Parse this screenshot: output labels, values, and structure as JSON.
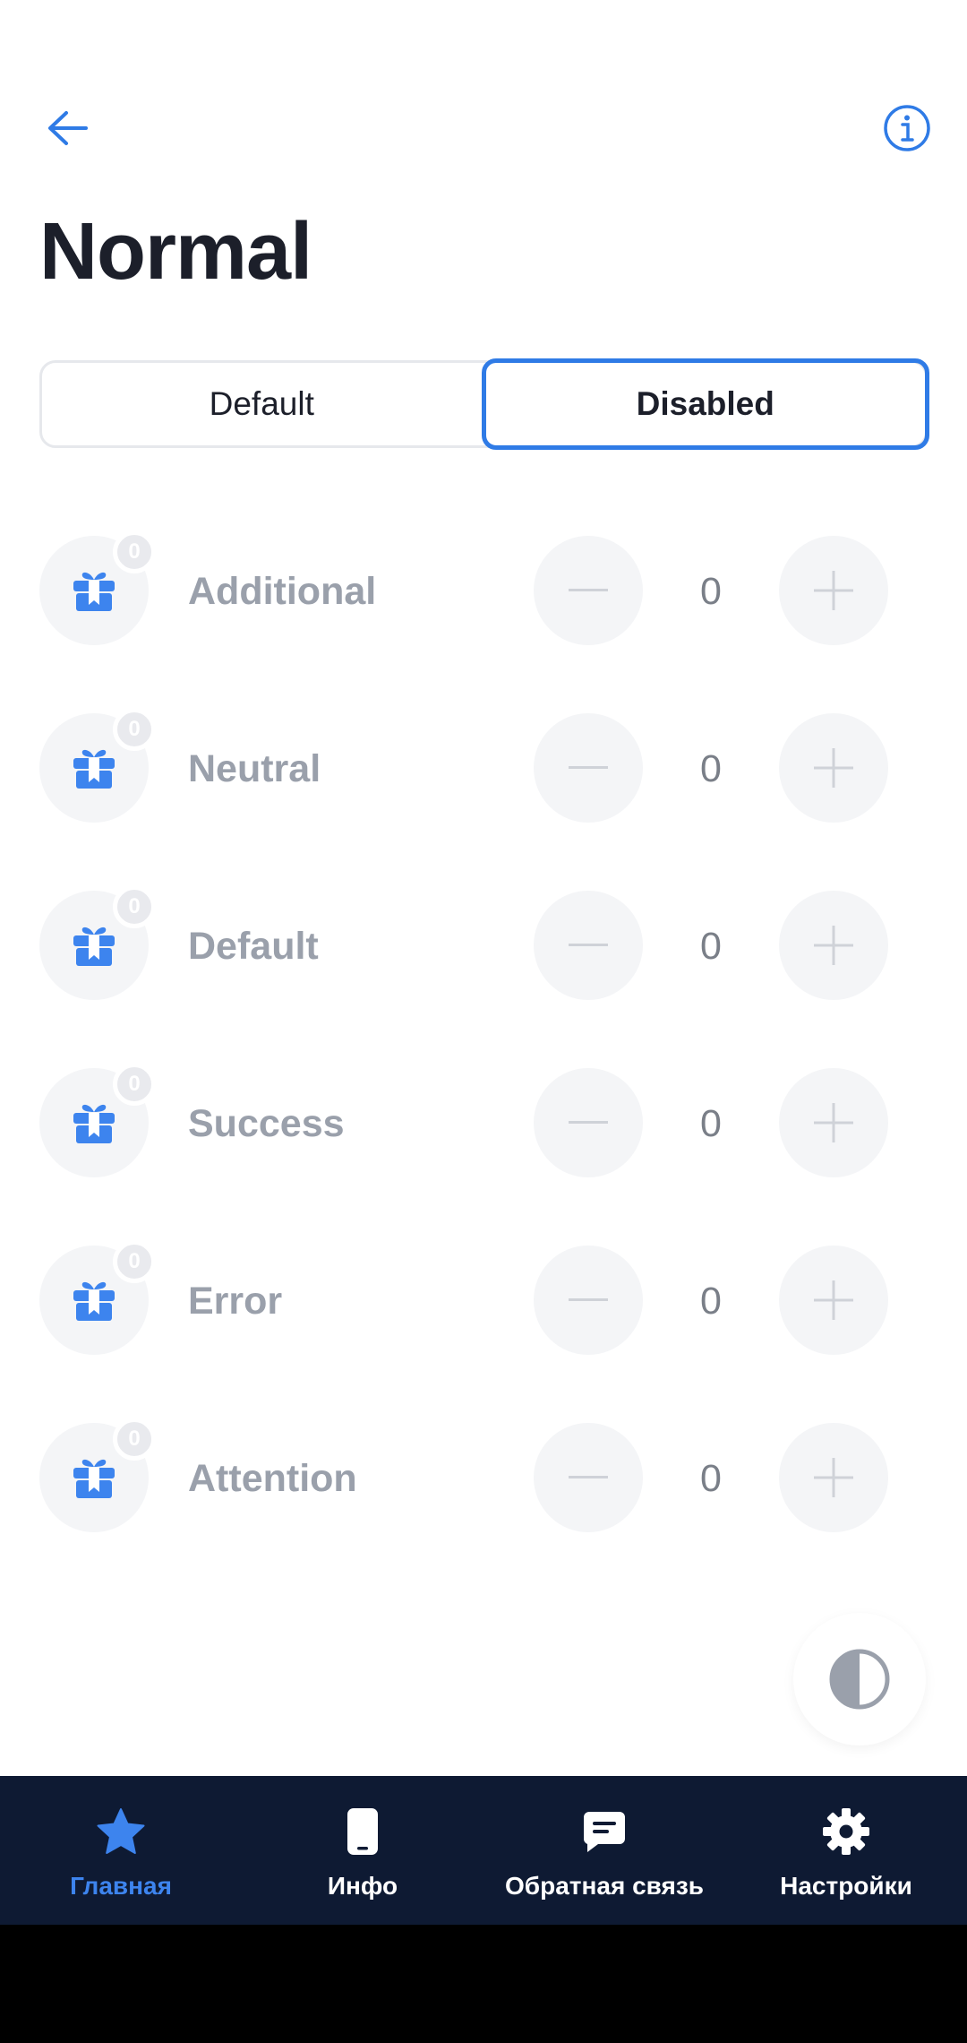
{
  "header": {
    "title": "Normal",
    "back_icon": "arrow-left-icon",
    "info_icon": "info-circle-icon"
  },
  "segmented": {
    "options": [
      "Default",
      "Disabled"
    ],
    "selected": "Disabled"
  },
  "rows": [
    {
      "label": "Additional",
      "badge": "0",
      "value": "0",
      "icon": "gift-icon"
    },
    {
      "label": "Neutral",
      "badge": "0",
      "value": "0",
      "icon": "gift-icon"
    },
    {
      "label": "Default",
      "badge": "0",
      "value": "0",
      "icon": "gift-icon"
    },
    {
      "label": "Success",
      "badge": "0",
      "value": "0",
      "icon": "gift-icon"
    },
    {
      "label": "Error",
      "badge": "0",
      "value": "0",
      "icon": "gift-icon"
    },
    {
      "label": "Attention",
      "badge": "0",
      "value": "0",
      "icon": "gift-icon"
    }
  ],
  "theme_toggle_icon": "contrast-icon",
  "bottom_nav": {
    "items": [
      {
        "label": "Главная",
        "icon": "star-icon",
        "active": true
      },
      {
        "label": "Инфо",
        "icon": "phone-icon",
        "active": false
      },
      {
        "label": "Обратная связь",
        "icon": "chat-icon",
        "active": false
      },
      {
        "label": "Настройки",
        "icon": "gear-icon",
        "active": false
      }
    ]
  },
  "colors": {
    "accent": "#2f7be6",
    "nav_background": "#0e1a33",
    "disabled_text": "#9aa0ab",
    "title_text": "#1c1f2a"
  }
}
